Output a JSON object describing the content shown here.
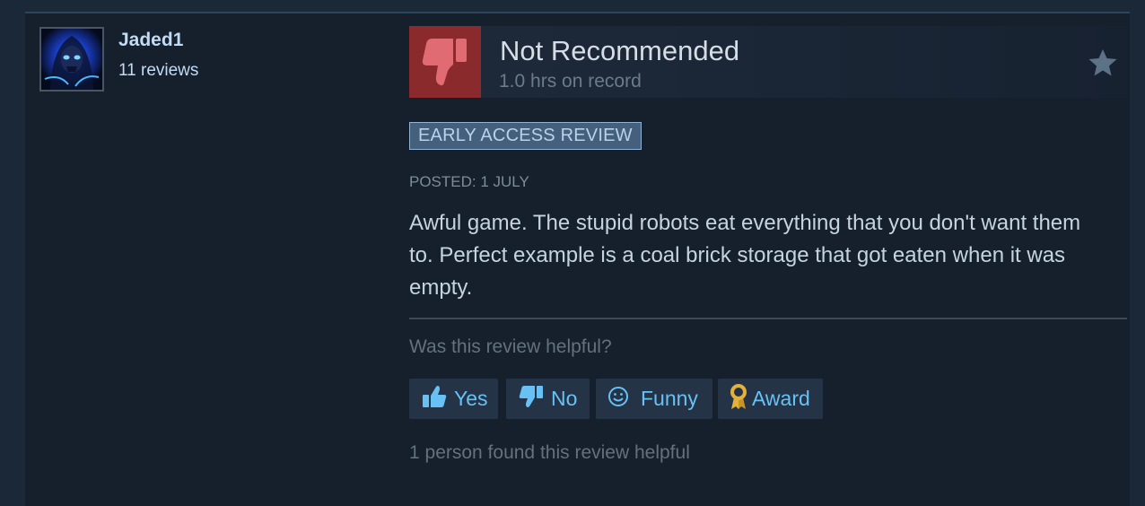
{
  "reviewer": {
    "username": "Jaded1",
    "review_count": "11 reviews"
  },
  "review": {
    "verdict": "Not Recommended",
    "hours": "1.0 hrs on record",
    "badge": "EARLY ACCESS REVIEW",
    "posted": "POSTED: 1 JULY",
    "text": "Awful game. The stupid robots eat everything that you don't want them to. Perfect example is a coal brick storage that got eaten when it was empty."
  },
  "helpful": {
    "question": "Was this review helpful?",
    "yes_label": "Yes",
    "no_label": "No",
    "funny_label": "Funny",
    "award_label": "Award",
    "found_text": "1 person found this review helpful"
  },
  "icons": {
    "thumb": "thumbs-down-icon",
    "star": "star-icon",
    "yes": "thumbs-up-icon",
    "no": "thumbs-down-icon",
    "funny": "smiley-icon",
    "award": "award-ribbon-icon"
  },
  "colors": {
    "page_background": "#1b2838",
    "card_background": "#16202d",
    "not_recommended_red": "#8a2a2c",
    "thumb_pink": "#e06b73",
    "link_blue": "#67c1f5",
    "badge_background": "#44607c",
    "award_gold": "#e4b23a"
  }
}
